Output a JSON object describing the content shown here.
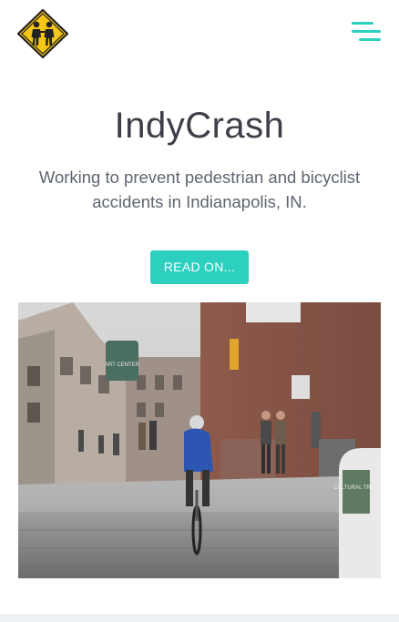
{
  "header": {
    "logo_icon": "pedestrian-crossing-sign-icon",
    "menu_icon": "hamburger-menu-icon",
    "accent_color": "#2bd0be",
    "logo_color": "#f5c518"
  },
  "hero": {
    "title": "IndyCrash",
    "subtitle": "Working to prevent pedestrian and bicyclist accidents in Indianapolis, IN.",
    "cta_label": "READ ON..."
  },
  "photo": {
    "sign_text": "CULTURAL TRAIL",
    "banner_text": "ART CENTER"
  }
}
